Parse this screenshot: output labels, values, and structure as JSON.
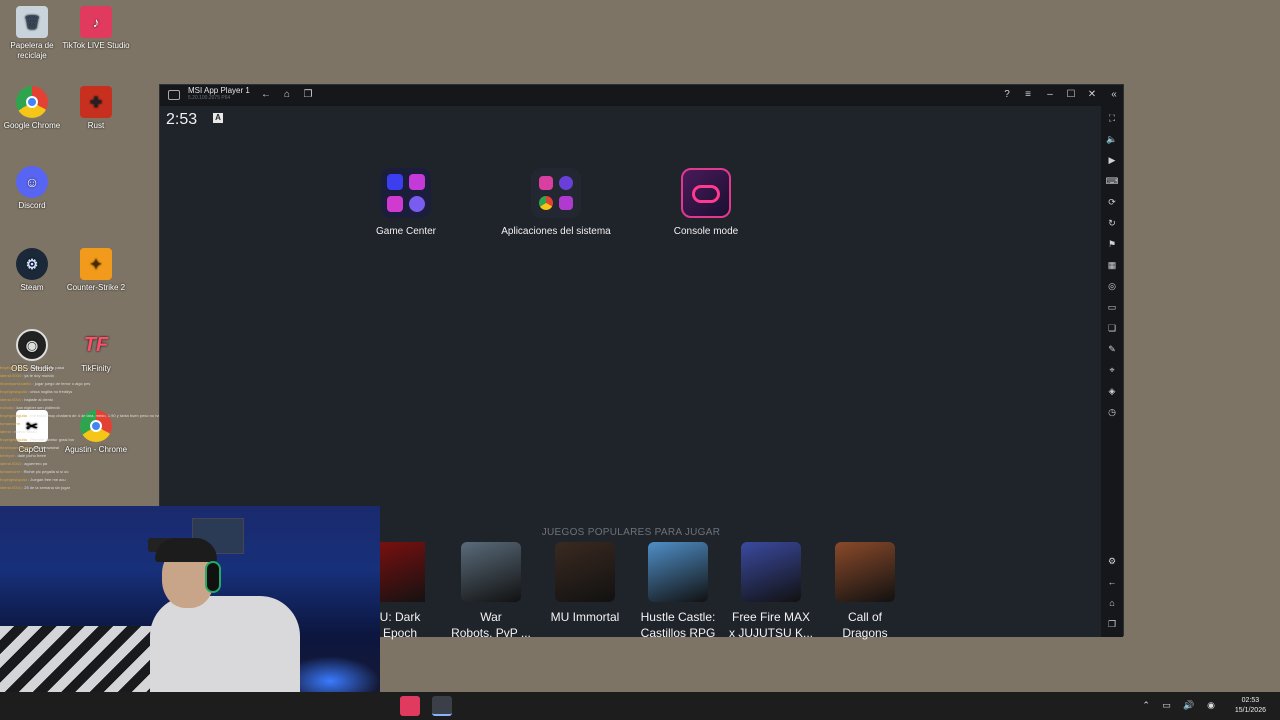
{
  "desktop": {
    "icons": [
      {
        "label": "Papelera de reciclaje",
        "icon": "recycle-bin-icon"
      },
      {
        "label": "TikTok LIVE Studio",
        "icon": "tiktok-icon"
      },
      {
        "label": "Google Chrome",
        "icon": "chrome-icon"
      },
      {
        "label": "Rust",
        "icon": "rust-icon"
      },
      {
        "label": "Discord",
        "icon": "discord-icon"
      },
      {
        "label": "Steam",
        "icon": "steam-icon"
      },
      {
        "label": "Counter-Strike 2",
        "icon": "counter-strike-icon"
      },
      {
        "label": "OBS Studio",
        "icon": "obs-icon"
      },
      {
        "label": "TikFinity",
        "icon": "tikfinity-icon"
      },
      {
        "label": "CapCut",
        "icon": "capcut-icon"
      },
      {
        "label": "Agustin - Chrome",
        "icon": "chrome-icon"
      }
    ]
  },
  "chat": {
    "rows": [
      {
        "user": "froyeigriskguita",
        "msg": "desde cuanto pasa"
      },
      {
        "user": "lateral.0004",
        "msg": "ya te doy mundo"
      },
      {
        "user": "ihrannyarskoaelio",
        "msg": "jugar juego de terror o algo pes"
      },
      {
        "user": "froyeigriskguita",
        "msg": "chica noglita no freddys"
      },
      {
        "user": "lateral.0004",
        "msg": "bajaste al ciento"
      },
      {
        "user": "nobody",
        "msg": "kan nigiber sen pidiendo"
      },
      {
        "user": "froyeigriskguita",
        "msg": "me estas muy chatarra de 4 de tara, medo, 1.90 y tanta buen peso no hay chance"
      },
      {
        "user": "tumaecurre",
        "msg": ""
      },
      {
        "user": "lateral",
        "msg": "nuevo xxaxd"
      },
      {
        "user": "froyeigriskguita",
        "msg": "Prenme diantur grasi bor"
      },
      {
        "user": "ihrannyarskoaelio",
        "msg": "Dc throwsteal"
      },
      {
        "user": "bertrywt",
        "msg": "dale pichu freee"
      },
      {
        "user": "lateral.0004",
        "msg": "aguerrero pa"
      },
      {
        "user": "tumaecurre",
        "msg": "Richie pic pegalla si si oo"
      },
      {
        "user": "froyeigriskguita",
        "msg": "Juegan free me acu"
      },
      {
        "user": "lateral.0004",
        "msg": "25 de la semana sin jugar"
      }
    ]
  },
  "emulator": {
    "title": "MSI App Player 1",
    "version": "5.20.100.2075 P64",
    "clock": "2:53",
    "status_badge": "A",
    "apps": [
      {
        "label": "Game Center"
      },
      {
        "label": "Aplicaciones del sistema"
      },
      {
        "label": "Console mode"
      }
    ],
    "popular_title": "JUEGOS POPULARES PARA JUGAR",
    "games": [
      {
        "line1": "U: Dark",
        "line2": "Epoch",
        "color": "#7a1010"
      },
      {
        "line1": "War",
        "line2": "Robots. PvP ...",
        "color": "#5a6b7a"
      },
      {
        "line1": "MU Immortal",
        "line2": "",
        "color": "#3a2a20"
      },
      {
        "line1": "Hustle Castle:",
        "line2": "Castillos RPG",
        "color": "#4f8fc8"
      },
      {
        "line1": "Free Fire MAX",
        "line2": "x JUJUTSU K...",
        "color": "#3b4aa0"
      },
      {
        "line1": "Call of",
        "line2": "Dragons",
        "color": "#8a4a2a"
      }
    ]
  },
  "taskbar": {
    "time": "02:53",
    "date": "15/1/2026"
  },
  "colors": {
    "desktop_bg": "#7d7465",
    "emulator_bg": "#1f232a",
    "accent": "#e03a5f"
  }
}
